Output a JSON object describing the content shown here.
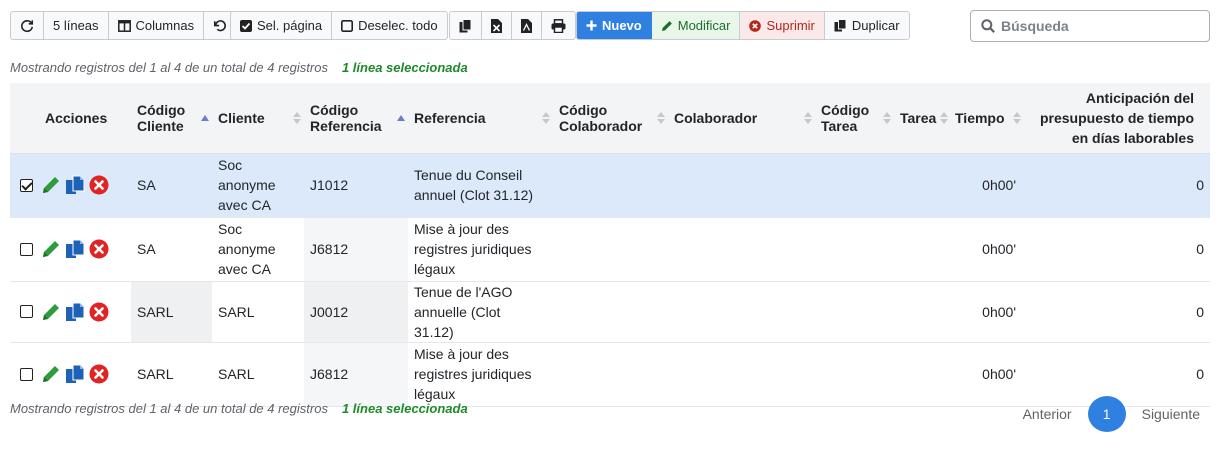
{
  "toolbar": {
    "lines_label": "5 líneas",
    "columns_label": "Columnas",
    "select_page_label": "Sel. página",
    "deselect_all_label": "Deselec. todo",
    "new_label": "Nuevo",
    "modify_label": "Modificar",
    "delete_label": "Suprimir",
    "duplicate_label": "Duplicar"
  },
  "search": {
    "placeholder": "Búsqueda"
  },
  "info": {
    "showing": "Mostrando registros del 1 al 4 de un total de 4 registros",
    "selected": "1 línea seleccionada"
  },
  "table": {
    "headers": {
      "acciones": "Acciones",
      "codigo_cliente": "Código Cliente",
      "cliente": "Cliente",
      "codigo_referencia": "Código Referencia",
      "referencia": "Referencia",
      "codigo_colaborador": "Código Colaborador",
      "colaborador": "Colaborador",
      "codigo_tarea": "Código Tarea",
      "tarea": "Tarea",
      "tiempo": "Tiempo",
      "anticipacion": "Anticipación del presupuesto de tiempo en días laborables"
    },
    "rows": [
      {
        "selected": true,
        "codigo_cliente": "SA",
        "cliente": "Soc anonyme avec CA",
        "codigo_referencia": "J1012",
        "referencia": "Tenue du Conseil annuel (Clot 31.12)",
        "codigo_colaborador": "",
        "colaborador": "",
        "codigo_tarea": "",
        "tarea": "",
        "tiempo": "0h00'",
        "anticipacion": "0"
      },
      {
        "selected": false,
        "codigo_cliente": "SA",
        "cliente": "Soc anonyme avec CA",
        "codigo_referencia": "J6812",
        "referencia": "Mise à jour des registres juridiques légaux",
        "codigo_colaborador": "",
        "colaborador": "",
        "codigo_tarea": "",
        "tarea": "",
        "tiempo": "0h00'",
        "anticipacion": "0"
      },
      {
        "selected": false,
        "codigo_cliente": "SARL",
        "cliente": "SARL",
        "codigo_referencia": "J0012",
        "referencia": "Tenue de l'AGO annuelle (Clot 31.12)",
        "codigo_colaborador": "",
        "colaborador": "",
        "codigo_tarea": "",
        "tarea": "",
        "tiempo": "0h00'",
        "anticipacion": "0"
      },
      {
        "selected": false,
        "codigo_cliente": "SARL",
        "cliente": "SARL",
        "codigo_referencia": "J6812",
        "referencia": "Mise à jour des registres juridiques légaux",
        "codigo_colaborador": "",
        "colaborador": "",
        "codigo_tarea": "",
        "tarea": "",
        "tiempo": "0h00'",
        "anticipacion": "0"
      }
    ]
  },
  "pagination": {
    "previous": "Anterior",
    "current_page": "1",
    "next": "Siguiente"
  },
  "colors": {
    "accent": "#2f80e0",
    "selected_row": "#dbe9fb",
    "success": "#1e8a2a",
    "danger": "#e02424",
    "edit_icon": "#2e9b3c",
    "copy_icon": "#1e62b8"
  }
}
